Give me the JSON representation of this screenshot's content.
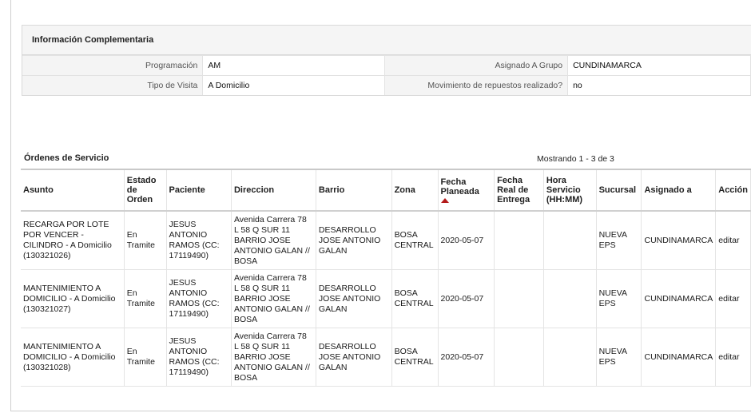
{
  "info": {
    "title": "Información Complementaria",
    "rows": [
      {
        "label1": "Programación",
        "value1": "AM",
        "label2": "Asignado A Grupo",
        "value2": "CUNDINAMARCA"
      },
      {
        "label1": "Tipo de Visita",
        "value1": "A Domicilio",
        "label2": "Movimiento de repuestos realizado?",
        "value2": "no"
      }
    ]
  },
  "orders": {
    "title": "Órdenes de Servicio",
    "count": "Mostrando 1 - 3 de 3",
    "headers": {
      "asunto": "Asunto",
      "estado": "Estado de Orden",
      "paciente": "Paciente",
      "direccion": "Direccion",
      "barrio": "Barrio",
      "zona": "Zona",
      "fecha_planeada": "Fecha Planeada",
      "fecha_real": "Fecha Real de Entrega",
      "hora": "Hora Servicio (HH:MM)",
      "sucursal": "Sucursal",
      "asignado": "Asignado a",
      "accion": "Acción"
    },
    "rows": [
      {
        "asunto": "RECARGA POR LOTE POR VENCER - CILINDRO - A Domicilio (130321026)",
        "estado": "En Tramite",
        "paciente": "JESUS ANTONIO RAMOS (CC: 17119490)",
        "direccion": "Avenida Carrera 78 L 58 Q SUR 11 BARRIO JOSE ANTONIO GALAN // BOSA",
        "barrio": "DESARROLLO JOSE ANTONIO GALAN",
        "zona": "BOSA CENTRAL",
        "fecha_planeada": "2020-05-07",
        "fecha_real": "",
        "hora": "",
        "sucursal": "NUEVA EPS",
        "asignado": "CUNDINAMARCA",
        "accion": "editar"
      },
      {
        "asunto": "MANTENIMIENTO A DOMICILIO - A Domicilio (130321027)",
        "estado": "En Tramite",
        "paciente": "JESUS ANTONIO RAMOS (CC: 17119490)",
        "direccion": "Avenida Carrera 78 L 58 Q SUR 11 BARRIO JOSE ANTONIO GALAN // BOSA",
        "barrio": "DESARROLLO JOSE ANTONIO GALAN",
        "zona": "BOSA CENTRAL",
        "fecha_planeada": "2020-05-07",
        "fecha_real": "",
        "hora": "",
        "sucursal": "NUEVA EPS",
        "asignado": "CUNDINAMARCA",
        "accion": "editar"
      },
      {
        "asunto": "MANTENIMIENTO A DOMICILIO - A Domicilio (130321028)",
        "estado": "En Tramite",
        "paciente": "JESUS ANTONIO RAMOS (CC: 17119490)",
        "direccion": "Avenida Carrera 78 L 58 Q SUR 11 BARRIO JOSE ANTONIO GALAN // BOSA",
        "barrio": "DESARROLLO JOSE ANTONIO GALAN",
        "zona": "BOSA CENTRAL",
        "fecha_planeada": "2020-05-07",
        "fecha_real": "",
        "hora": "",
        "sucursal": "NUEVA EPS",
        "asignado": "CUNDINAMARCA",
        "accion": "editar"
      }
    ]
  },
  "icons": {
    "sort": "sort-ascending-icon"
  },
  "colors": {
    "sort_arrow": "#b31a1a",
    "header_bg": "#f5f5f5"
  }
}
